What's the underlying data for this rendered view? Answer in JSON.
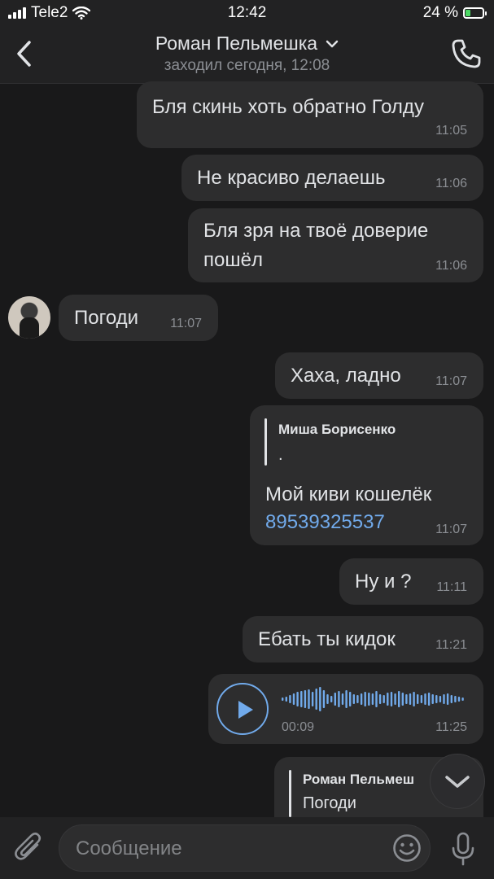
{
  "status_bar": {
    "carrier": "Tele2",
    "time": "12:42",
    "battery": "24 %",
    "battery_level": 0.24
  },
  "header": {
    "title": "Роман Пельмешка",
    "subtitle": "заходил сегодня, 12:08"
  },
  "messages": [
    {
      "text": "Бля скинь хоть обратно Голду",
      "time": "11:05",
      "side": "out"
    },
    {
      "text": "Не красиво делаешь",
      "time": "11:06",
      "side": "out"
    },
    {
      "text_line1": "Бля зря на твоё доверие",
      "text_line2": "пошёл",
      "time": "11:06",
      "side": "out"
    },
    {
      "text": "Погоди",
      "time": "11:07",
      "side": "in"
    },
    {
      "text": "Хаха, ладно",
      "time": "11:07",
      "side": "out"
    },
    {
      "reply_name": "Миша Борисенко",
      "reply_text": ".",
      "text": "Мой киви кошелёк",
      "phone": "89539325537",
      "time": "11:07",
      "side": "out"
    },
    {
      "text": "Ну и ?",
      "time": "11:11",
      "side": "out"
    },
    {
      "text": "Ебать ты кидок",
      "time": "11:21",
      "side": "out"
    },
    {
      "type": "voice",
      "duration": "00:09",
      "time": "11:25",
      "side": "out"
    },
    {
      "reply_name": "Роман Пельмеш",
      "reply_text": "Погоди",
      "side": "out"
    }
  ],
  "composer": {
    "placeholder": "Сообщение"
  },
  "colors": {
    "background": "#19191a",
    "bubble": "#2d2d2e",
    "accent": "#71aaeb",
    "text": "#e1e3e6",
    "muted": "#8b8e93"
  },
  "icons": [
    "signal-icon",
    "wifi-icon",
    "battery-icon",
    "back-arrow-icon",
    "chevron-down-icon",
    "phone-icon",
    "play-icon",
    "scroll-down-icon",
    "paperclip-icon",
    "emoji-icon",
    "mic-icon"
  ]
}
